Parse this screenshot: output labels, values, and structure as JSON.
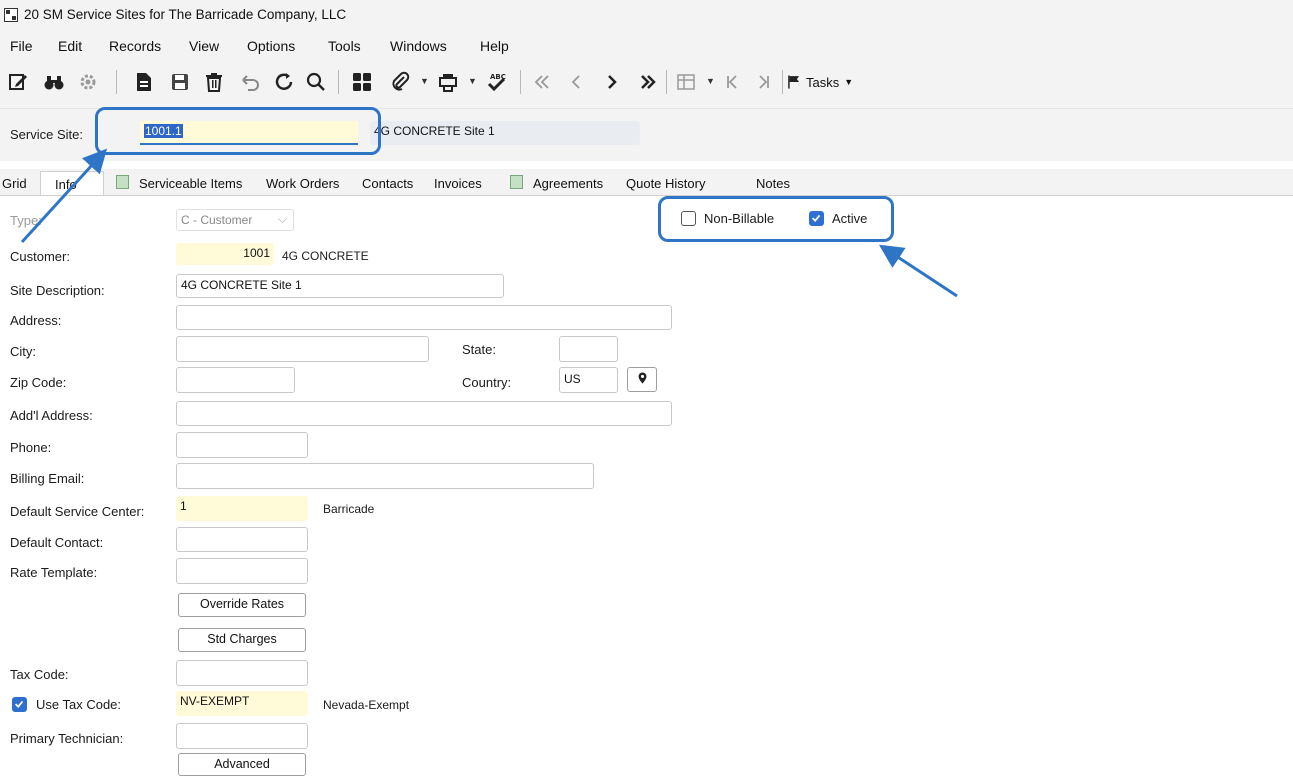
{
  "window": {
    "title": "20 SM Service Sites for The Barricade Company, LLC"
  },
  "menu": [
    "File",
    "Edit",
    "Records",
    "View",
    "Options",
    "Tools",
    "Windows",
    "Help"
  ],
  "toolbar": {
    "icons": [
      "edit-icon",
      "binoculars-icon",
      "gear-icon",
      "new-document-icon",
      "save-icon",
      "delete-icon",
      "undo-icon",
      "refresh-icon",
      "search-icon",
      "grid-icon",
      "attach-icon",
      "print-icon",
      "spellcheck-icon",
      "first-record-icon",
      "previous-record-icon",
      "next-record-icon",
      "last-record-icon",
      "table-view-icon",
      "first-page-icon",
      "last-page-icon",
      "flag-icon"
    ],
    "tasks_label": "Tasks"
  },
  "header": {
    "service_site_label": "Service Site:",
    "service_site_value": "1001.1",
    "service_site_desc": "4G CONCRETE Site 1"
  },
  "tabs": [
    "Grid",
    "Info",
    "Serviceable Items",
    "Work Orders",
    "Contacts",
    "Invoices",
    "Agreements",
    "Quote History",
    "Notes"
  ],
  "active_tab": "Info",
  "form": {
    "type_label": "Type:",
    "type_value": "C - Customer",
    "non_billable_label": "Non-Billable",
    "non_billable_checked": false,
    "active_label": "Active",
    "active_checked": true,
    "customer_label": "Customer:",
    "customer_number": "1001",
    "customer_name": "4G CONCRETE",
    "site_description_label": "Site Description:",
    "site_description_value": "4G CONCRETE Site 1",
    "address_label": "Address:",
    "address_value": "",
    "city_label": "City:",
    "city_value": "",
    "state_label": "State:",
    "state_value": "",
    "zip_label": "Zip Code:",
    "zip_value": "",
    "country_label": "Country:",
    "country_value": "US",
    "addl_address_label": "Add'l Address:",
    "addl_address_value": "",
    "phone_label": "Phone:",
    "phone_value": "",
    "billing_email_label": "Billing Email:",
    "billing_email_value": "",
    "default_service_center_label": "Default Service Center:",
    "default_service_center_value": "1",
    "default_service_center_name": "Barricade",
    "default_contact_label": "Default Contact:",
    "default_contact_value": "",
    "rate_template_label": "Rate Template:",
    "rate_template_value": "",
    "override_rates_button": "Override Rates",
    "std_charges_button": "Std Charges",
    "tax_code_label": "Tax Code:",
    "tax_code_value": "",
    "use_tax_code_label": "Use Tax Code:",
    "use_tax_code_checked": true,
    "use_tax_code_value": "NV-EXEMPT",
    "use_tax_code_name": "Nevada-Exempt",
    "primary_technician_label": "Primary Technician:",
    "primary_technician_value": "",
    "advanced_button": "Advanced"
  },
  "colors": {
    "callout": "#2e75c8",
    "highlight_field": "#fffbd9",
    "checkbox_checked": "#2e6fd1"
  }
}
